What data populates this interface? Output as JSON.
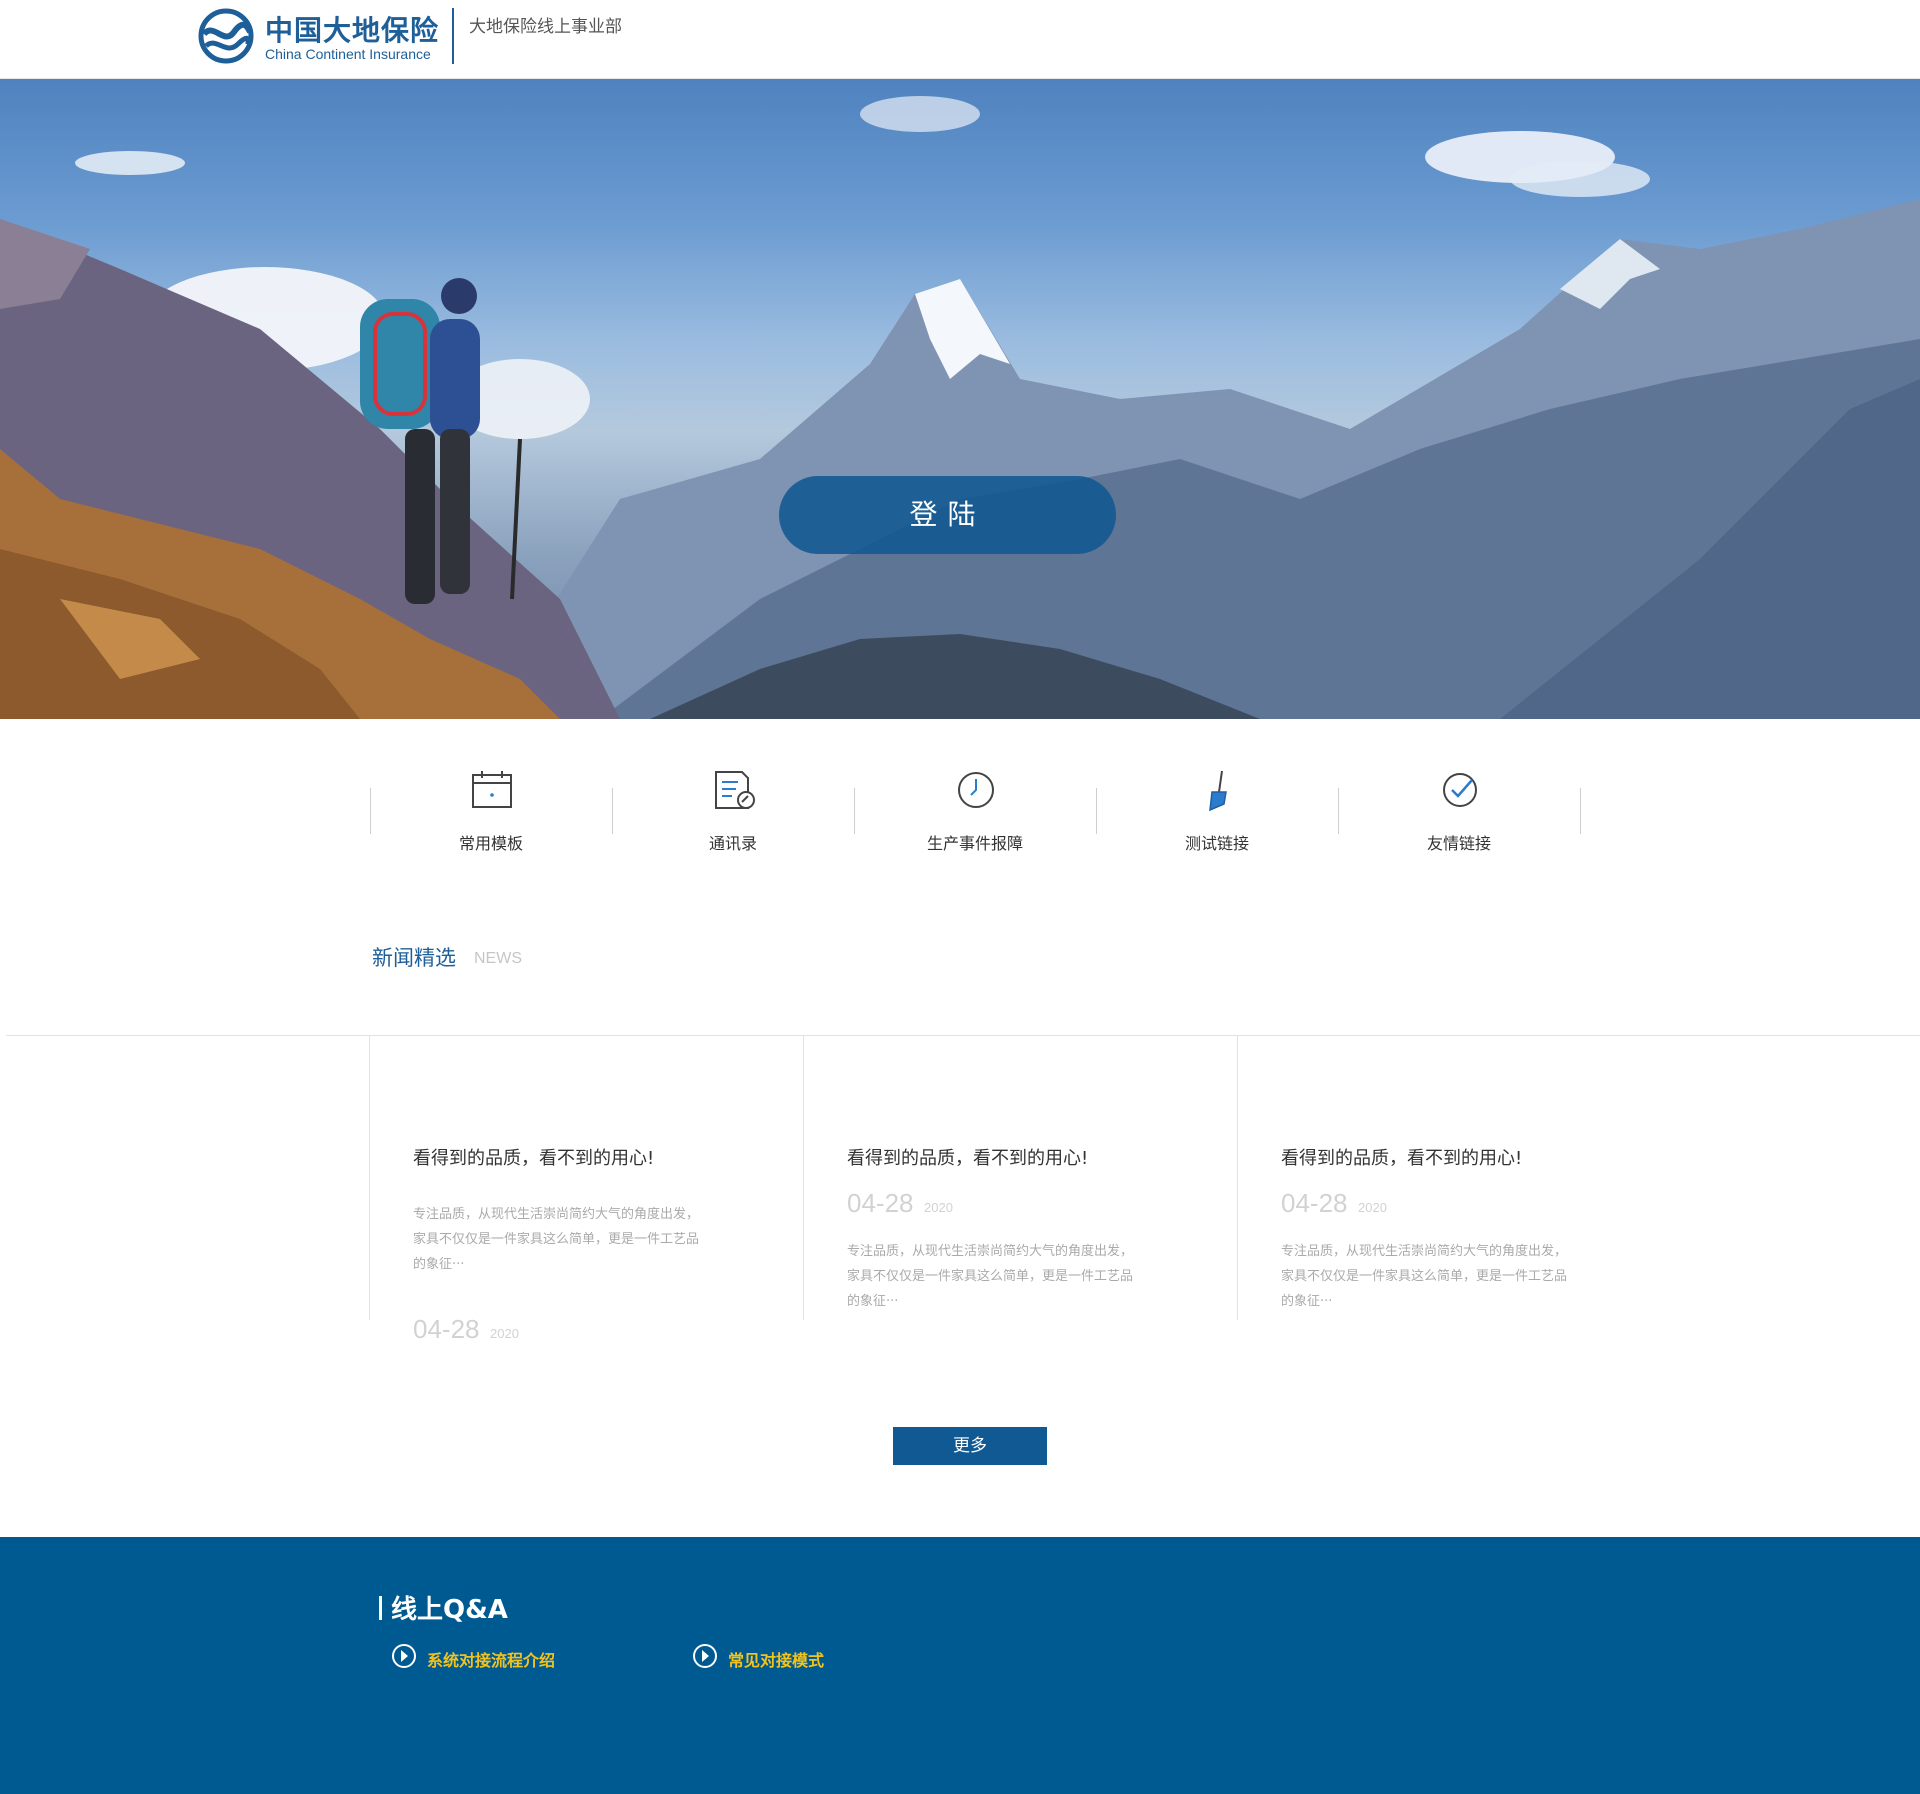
{
  "header": {
    "brand_cn": "中国大地保险",
    "brand_en": "China Continent Insurance",
    "department": "大地保险线上事业部"
  },
  "hero": {
    "login_label": "登陆"
  },
  "quick_links": [
    {
      "label": "常用模板",
      "icon": "calendar-icon"
    },
    {
      "label": "通讯录",
      "icon": "contacts-icon"
    },
    {
      "label": "生产事件报障",
      "icon": "clock-icon"
    },
    {
      "label": "测试链接",
      "icon": "brush-icon"
    },
    {
      "label": "友情链接",
      "icon": "check-circle-icon"
    }
  ],
  "news": {
    "title": "新闻精选",
    "subtitle": "NEWS",
    "cards": [
      {
        "title": "看得到的品质，看不到的用心!",
        "desc": "专注品质，从现代生活崇尚简约大气的角度出发，家具不仅仅是一件家具这么简单，更是一件工艺品的象征···",
        "date": "04-28",
        "year": "2020"
      },
      {
        "title": "看得到的品质，看不到的用心!",
        "desc": "专注品质，从现代生活崇尚简约大气的角度出发，家具不仅仅是一件家具这么简单，更是一件工艺品的象征···",
        "date": "04-28",
        "year": "2020"
      },
      {
        "title": "看得到的品质，看不到的用心!",
        "desc": "专注品质，从现代生活崇尚简约大气的角度出发，家具不仅仅是一件家具这么简单，更是一件工艺品的象征···",
        "date": "04-28",
        "year": "2020"
      }
    ],
    "more_label": "更多"
  },
  "footer": {
    "qa_title": "线上Q&A",
    "links": [
      {
        "label": "系统对接流程介绍",
        "icon": "arrow-circle-icon"
      },
      {
        "label": "常见对接模式",
        "icon": "arrow-circle-icon"
      }
    ]
  },
  "colors": {
    "brand_blue": "#1e5f99",
    "button_blue": "#115992",
    "footer_blue": "#005a92",
    "link_yellow": "#f2c31e"
  }
}
